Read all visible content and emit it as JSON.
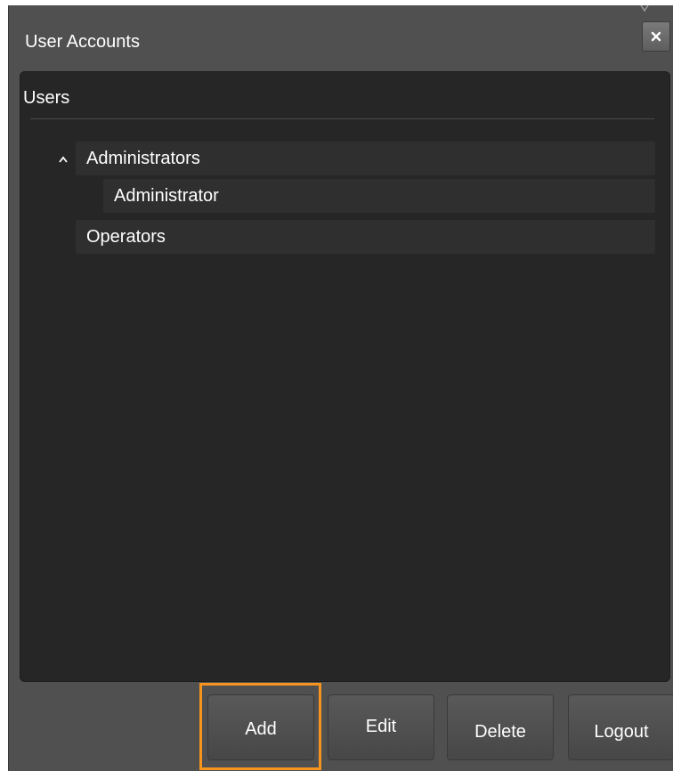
{
  "window": {
    "title": "User Accounts",
    "close_icon": "close-icon"
  },
  "users_panel": {
    "header": "Users",
    "tree": [
      {
        "label": "Administrators",
        "expanded": true,
        "children": [
          {
            "label": "Administrator"
          }
        ]
      },
      {
        "label": "Operators"
      }
    ]
  },
  "buttons": {
    "add": "Add",
    "edit": "Edit",
    "delete": "Delete",
    "logout": "Logout",
    "highlighted": "add"
  },
  "colors": {
    "dialog_bg": "#505050",
    "panel_bg": "#262626",
    "highlight": "#f7941d"
  }
}
